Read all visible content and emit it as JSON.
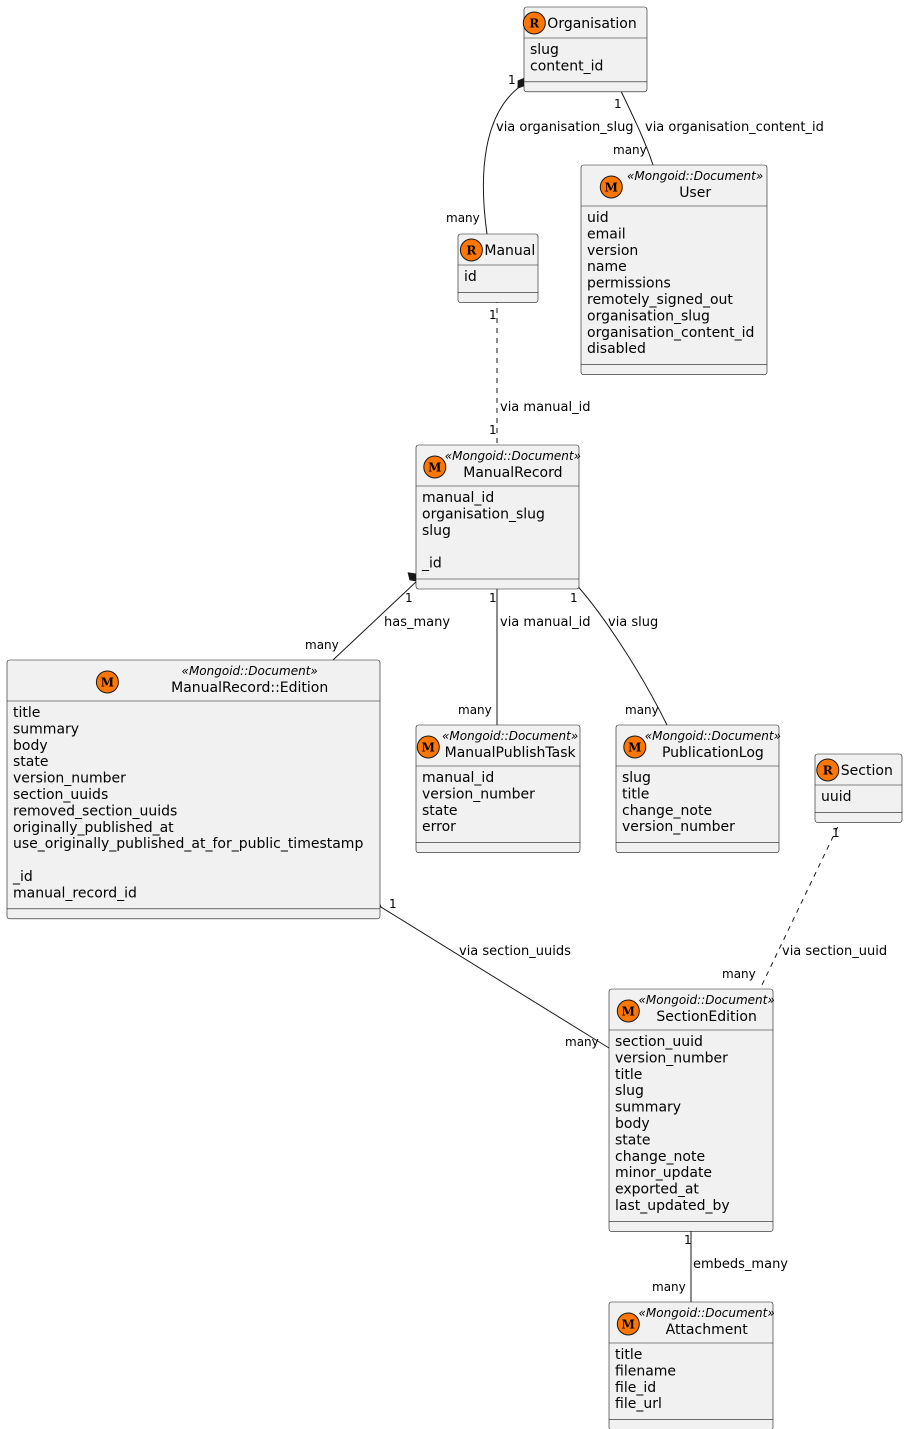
{
  "colors": {
    "spot": "#FF7700",
    "box_fill": "#F1F1F1",
    "line": "#181818"
  },
  "classes": [
    {
      "id": "organisation",
      "name": "Organisation",
      "spot": "R",
      "stereotype": "",
      "fields": [
        "slug",
        "content_id"
      ]
    },
    {
      "id": "manual",
      "name": "Manual",
      "spot": "R",
      "stereotype": "",
      "fields": [
        "id"
      ]
    },
    {
      "id": "user",
      "name": "User",
      "spot": "M",
      "stereotype": "«Mongoid::Document»",
      "fields": [
        "uid",
        "email",
        "version",
        "name",
        "permissions",
        "remotely_signed_out",
        "organisation_slug",
        "organisation_content_id",
        "disabled"
      ]
    },
    {
      "id": "manual-record",
      "name": "ManualRecord",
      "spot": "M",
      "stereotype": "«Mongoid::Document»",
      "fields": [
        "manual_id",
        "organisation_slug",
        "slug",
        "",
        "_id"
      ]
    },
    {
      "id": "manual-record-edition",
      "name": "ManualRecord::Edition",
      "spot": "M",
      "stereotype": "«Mongoid::Document»",
      "fields": [
        "title",
        "summary",
        "body",
        "state",
        "version_number",
        "section_uuids",
        "removed_section_uuids",
        "originally_published_at",
        "use_originally_published_at_for_public_timestamp",
        "",
        "_id",
        "manual_record_id"
      ]
    },
    {
      "id": "manual-publish-task",
      "name": "ManualPublishTask",
      "spot": "M",
      "stereotype": "«Mongoid::Document»",
      "fields": [
        "manual_id",
        "version_number",
        "state",
        "error"
      ]
    },
    {
      "id": "publication-log",
      "name": "PublicationLog",
      "spot": "M",
      "stereotype": "«Mongoid::Document»",
      "fields": [
        "slug",
        "title",
        "change_note",
        "version_number"
      ]
    },
    {
      "id": "section",
      "name": "Section",
      "spot": "R",
      "stereotype": "",
      "fields": [
        "uuid"
      ]
    },
    {
      "id": "section-edition",
      "name": "SectionEdition",
      "spot": "M",
      "stereotype": "«Mongoid::Document»",
      "fields": [
        "section_uuid",
        "version_number",
        "title",
        "slug",
        "summary",
        "body",
        "state",
        "change_note",
        "minor_update",
        "exported_at",
        "last_updated_by"
      ]
    },
    {
      "id": "attachment",
      "name": "Attachment",
      "spot": "M",
      "stereotype": "«Mongoid::Document»",
      "fields": [
        "title",
        "filename",
        "file_id",
        "file_url"
      ]
    }
  ],
  "relations": [
    {
      "from": "organisation",
      "to": "manual",
      "label": "via organisation_slug",
      "from_mult": "1",
      "to_mult": "many",
      "kind": "composition",
      "style": "solid"
    },
    {
      "from": "organisation",
      "to": "user",
      "label": "via organisation_content_id",
      "from_mult": "1",
      "to_mult": "many",
      "kind": "composition",
      "style": "solid"
    },
    {
      "from": "manual",
      "to": "manual-record",
      "label": "via manual_id",
      "from_mult": "1",
      "to_mult": "1",
      "kind": "association",
      "style": "dashed"
    },
    {
      "from": "manual-record",
      "to": "manual-record-edition",
      "label": "has_many",
      "from_mult": "1",
      "to_mult": "many",
      "kind": "composition",
      "style": "solid"
    },
    {
      "from": "manual-record",
      "to": "manual-publish-task",
      "label": "via manual_id",
      "from_mult": "1",
      "to_mult": "many",
      "kind": "composition",
      "style": "solid"
    },
    {
      "from": "manual-record",
      "to": "publication-log",
      "label": "via slug",
      "from_mult": "1",
      "to_mult": "many",
      "kind": "composition",
      "style": "solid"
    },
    {
      "from": "manual-record-edition",
      "to": "section-edition",
      "label": "via section_uuids",
      "from_mult": "1",
      "to_mult": "many",
      "kind": "composition",
      "style": "solid"
    },
    {
      "from": "section",
      "to": "section-edition",
      "label": "via section_uuid",
      "from_mult": "1",
      "to_mult": "many",
      "kind": "composition",
      "style": "dashed"
    },
    {
      "from": "section-edition",
      "to": "attachment",
      "label": "embeds_many",
      "from_mult": "1",
      "to_mult": "many",
      "kind": "aggregation",
      "style": "solid"
    }
  ]
}
